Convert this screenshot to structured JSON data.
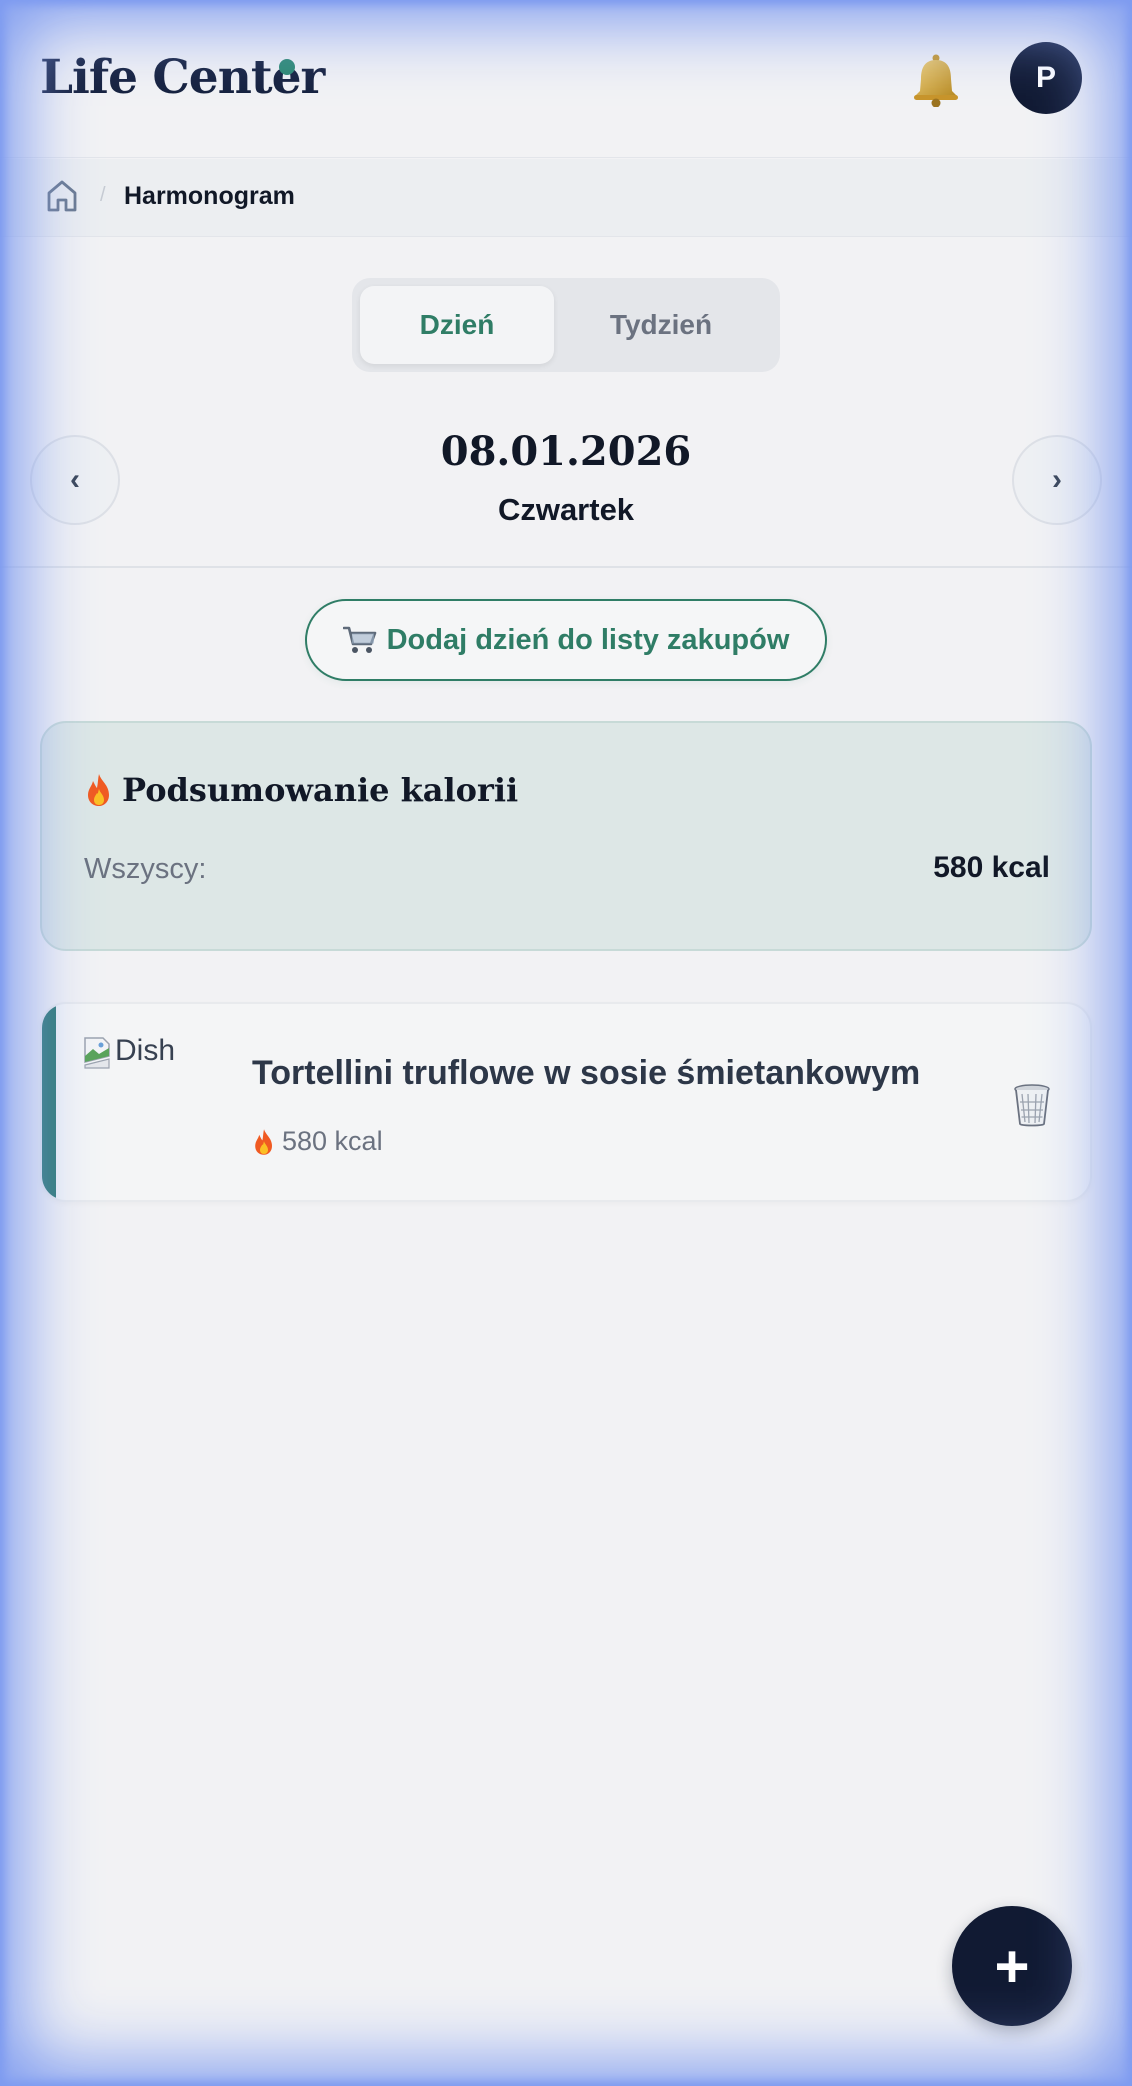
{
  "header": {
    "brand": "Life Center",
    "avatar_initial": "P"
  },
  "breadcrumb": {
    "current": "Harmonogram",
    "separator": "/"
  },
  "view_toggle": {
    "day_label": "Dzień",
    "week_label": "Tydzień",
    "active": "day"
  },
  "date_nav": {
    "prev_label": "‹",
    "next_label": "›",
    "date": "08.01.2026",
    "weekday": "Czwartek"
  },
  "shopping": {
    "label": "Dodaj dzień do listy zakupów"
  },
  "summary": {
    "title": "Podsumowanie kalorii",
    "label": "Wszyscy:",
    "value": "580 kcal"
  },
  "meals": [
    {
      "image_alt": "Dish",
      "title": "Tortellini truflowe w sosie śmietankowym",
      "kcal": "580 kcal"
    }
  ],
  "fab": {
    "label": "+"
  },
  "colors": {
    "accent": "#2f7d66",
    "dark": "#111a33",
    "brand_dot": "#2f8a73",
    "meal_accent": "#2f7a73"
  },
  "icons": [
    "bell-icon",
    "home-icon",
    "cart-icon",
    "fire-icon",
    "trash-icon",
    "broken-image-icon"
  ]
}
